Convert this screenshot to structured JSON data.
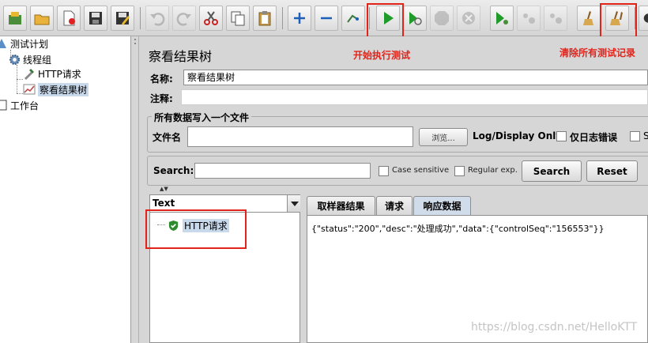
{
  "toolbar": {
    "buttons": [
      "templates",
      "open",
      "close-file",
      "save",
      "save-as",
      "undo",
      "redo",
      "cut",
      "copy",
      "paste",
      "expand",
      "collapse",
      "toggle",
      "start",
      "start-no-pause",
      "stop",
      "shutdown",
      "remote-start",
      "remote-stop",
      "remote-shutdown",
      "clear",
      "clear-all"
    ]
  },
  "annotations": {
    "start_label": "开始执行测试",
    "clear_label": "清除所有测试记录",
    "color": "#e2231a"
  },
  "tree": {
    "items": [
      {
        "label": "测试计划"
      },
      {
        "label": "线程组"
      },
      {
        "label": "HTTP请求"
      },
      {
        "label": "察看结果树"
      },
      {
        "label": "工作台"
      }
    ]
  },
  "panel": {
    "title": "察看结果树",
    "name_label": "名称:",
    "name_value": "察看结果树",
    "comment_label": "注释:",
    "comment_value": "",
    "file_group_title": "所有数据写入一个文件",
    "filename_label": "文件名",
    "filename_value": "",
    "browse_label": "浏览...",
    "log_only_label": "Log/Display Only:",
    "errors_only_label": "仅日志错误",
    "success_cut_label": "S"
  },
  "search": {
    "label": "Search:",
    "value": "",
    "case_sensitive_label": "Case sensitive",
    "regex_label": "Regular exp.",
    "search_button": "Search",
    "reset_button": "Reset"
  },
  "results": {
    "renderer": "Text",
    "samples": [
      {
        "label": "HTTP请求",
        "status": "success"
      }
    ],
    "tabs": [
      {
        "label": "取样器结果",
        "active": false
      },
      {
        "label": "请求",
        "active": false
      },
      {
        "label": "响应数据",
        "active": true
      }
    ],
    "response_body": "{\"status\":\"200\",\"desc\":\"处理成功\",\"data\":{\"controlSeq\":\"156553\"}}"
  },
  "watermark": "https://blog.csdn.net/HelloKTT"
}
